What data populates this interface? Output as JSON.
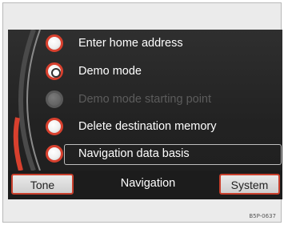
{
  "menu": {
    "items": [
      {
        "label": "Enter home address",
        "state": "normal"
      },
      {
        "label": "Demo mode",
        "state": "selected"
      },
      {
        "label": "Demo mode starting point",
        "state": "disabled"
      },
      {
        "label": "Delete destination memory",
        "state": "normal"
      },
      {
        "label": "Navigation data basis",
        "state": "highlighted"
      }
    ]
  },
  "tabs": {
    "left": "Tone",
    "center": "Navigation",
    "right": "System"
  },
  "watermark": "B5P-0637",
  "colors": {
    "accent": "#d8402e",
    "screen_bg": "#2a2a2a",
    "text": "#ffffff",
    "disabled_text": "#5c5c5c",
    "frame_bg": "#ebebeb"
  }
}
